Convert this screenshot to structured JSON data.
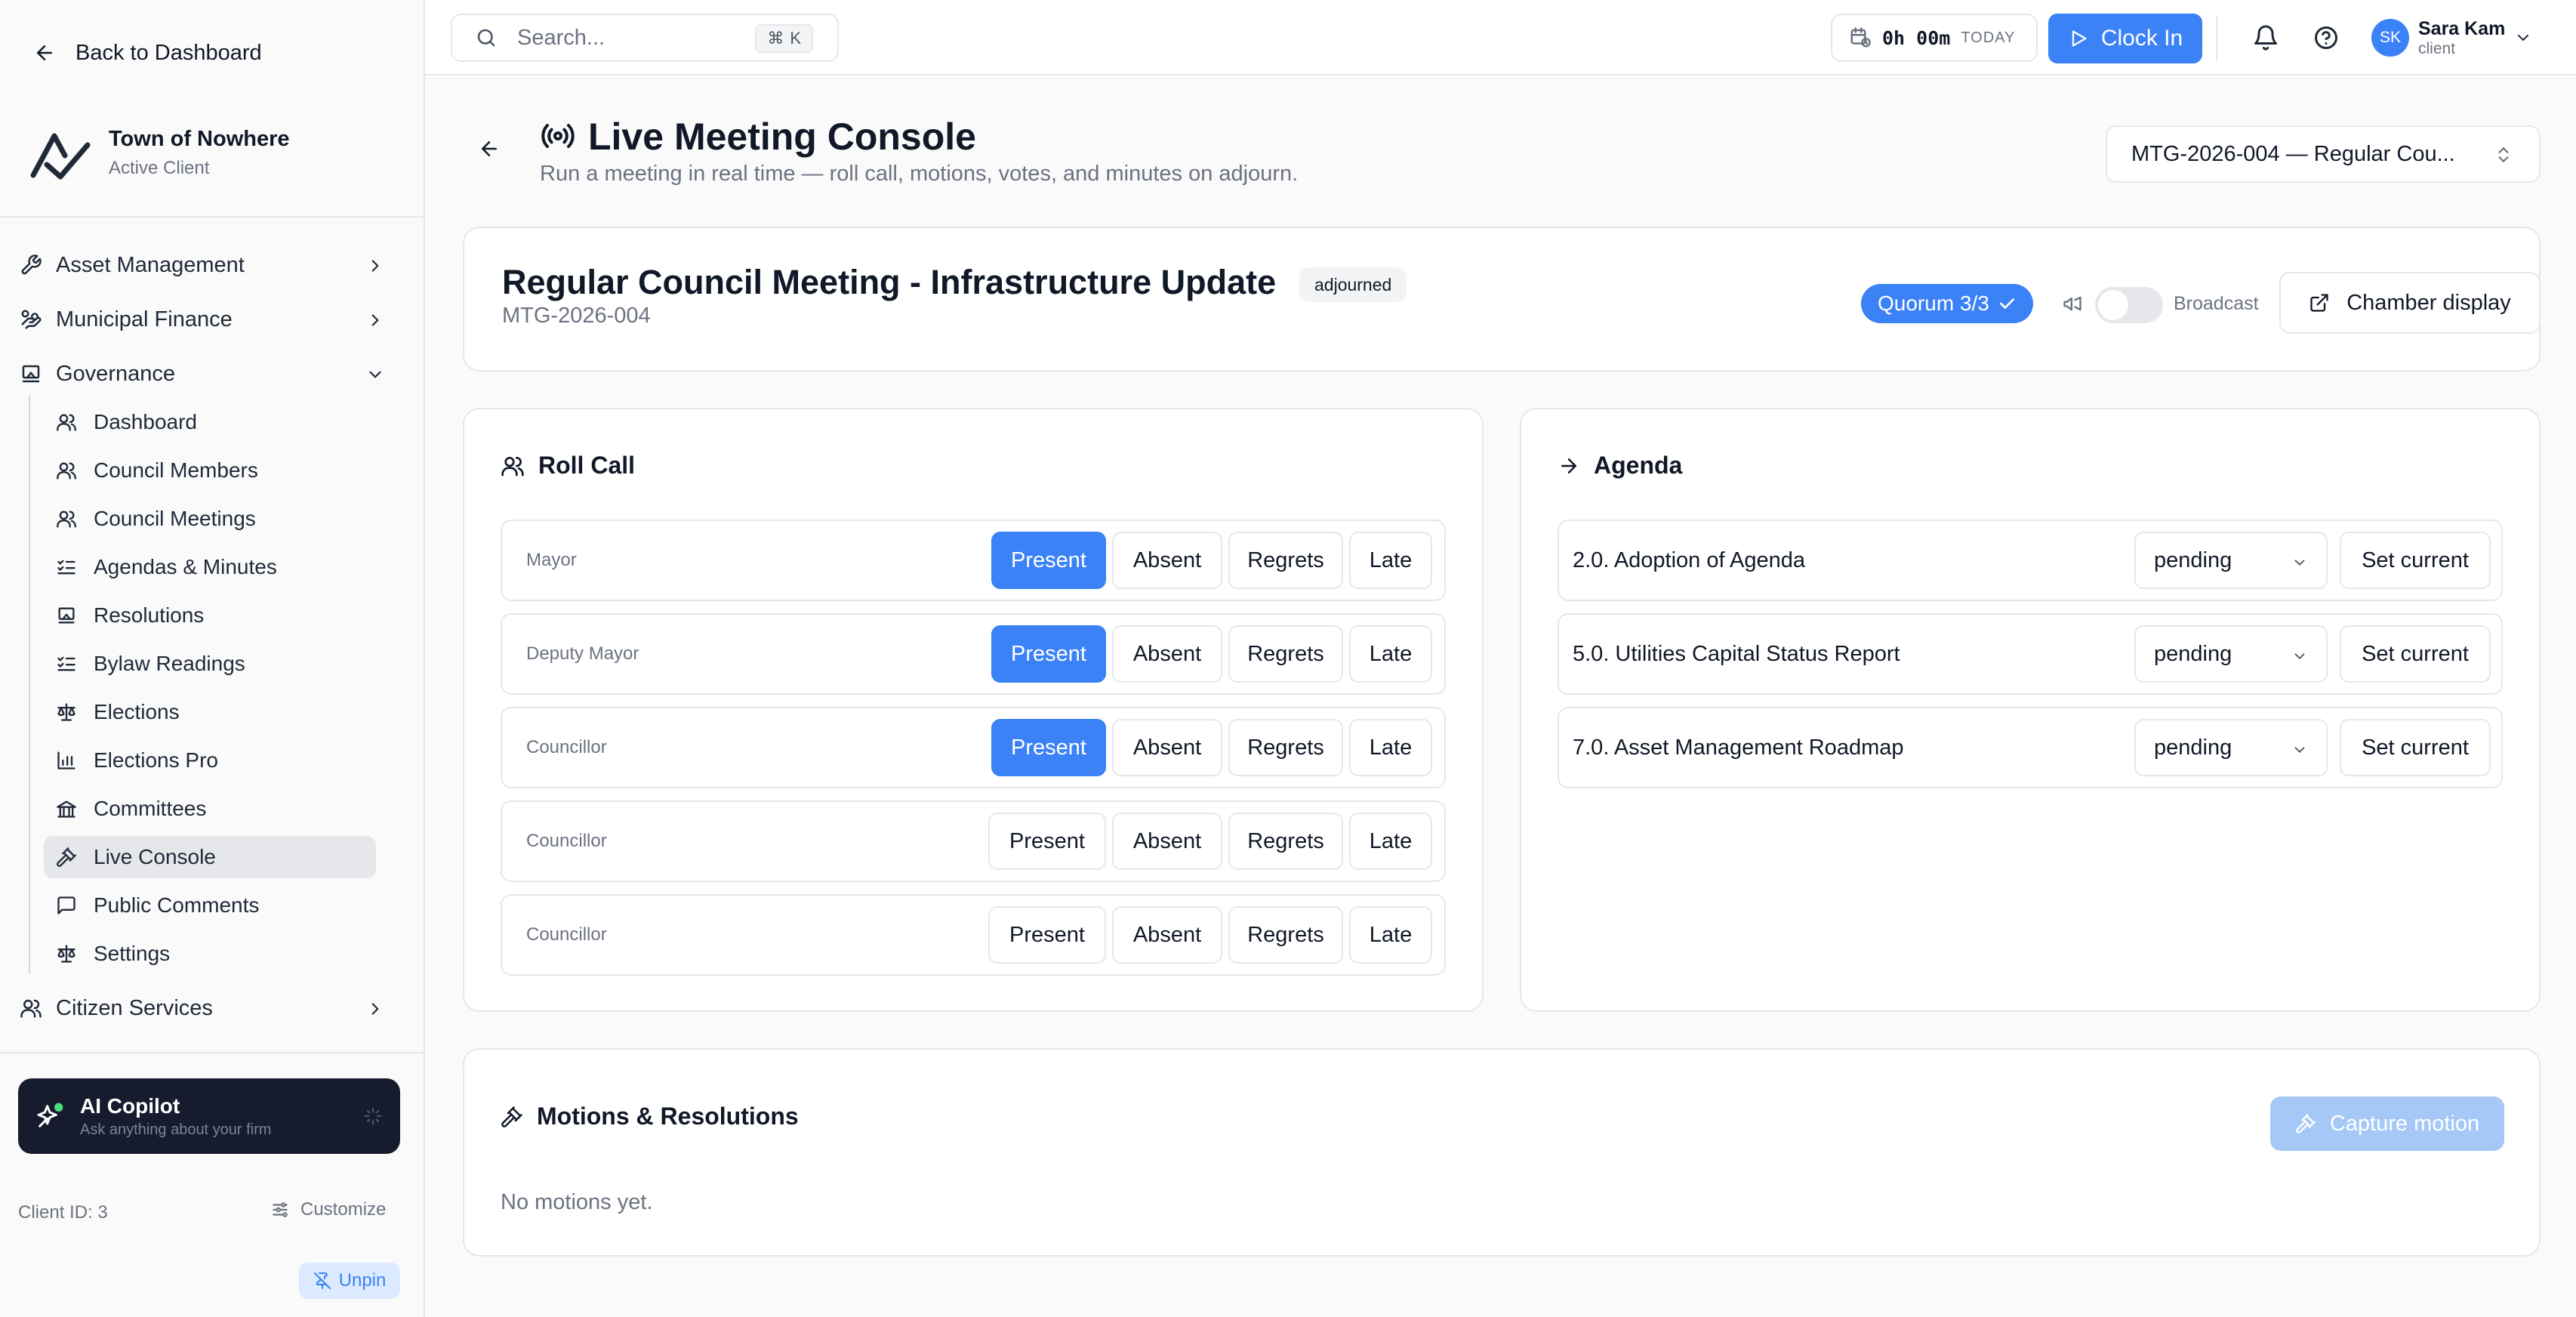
{
  "sidebar": {
    "back_label": "Back to Dashboard",
    "client_name": "Town of Nowhere",
    "client_status": "Active Client",
    "groups": [
      {
        "label": "Asset Management",
        "icon": "wrench-icon"
      },
      {
        "label": "Municipal Finance",
        "icon": "hand-coins-icon"
      },
      {
        "label": "Governance",
        "icon": "landmark-icon"
      },
      {
        "label": "Citizen Services",
        "icon": "users-icon"
      }
    ],
    "items": [
      {
        "label": "Dashboard",
        "icon": "users-icon"
      },
      {
        "label": "Council Members",
        "icon": "users-icon"
      },
      {
        "label": "Council Meetings",
        "icon": "users-icon"
      },
      {
        "label": "Agendas & Minutes",
        "icon": "list-checks-icon"
      },
      {
        "label": "Resolutions",
        "icon": "landmark-icon"
      },
      {
        "label": "Bylaw Readings",
        "icon": "list-checks-icon"
      },
      {
        "label": "Elections",
        "icon": "scale-icon"
      },
      {
        "label": "Elections Pro",
        "icon": "bar-chart-icon"
      },
      {
        "label": "Committees",
        "icon": "building-icon"
      },
      {
        "label": "Live Console",
        "icon": "gavel-icon"
      },
      {
        "label": "Public Comments",
        "icon": "message-square-icon"
      },
      {
        "label": "Settings",
        "icon": "scale-icon"
      }
    ],
    "active_item": "Live Console",
    "copilot_title": "AI Copilot",
    "copilot_sub": "Ask anything about your firm",
    "client_id": "Client ID: 3",
    "customize_label": "Customize",
    "unpin_label": "Unpin"
  },
  "topbar": {
    "search_placeholder": "Search...",
    "shortcut_symbol": "⌘",
    "shortcut_key": "K",
    "timer_value": "0h 00m",
    "timer_period": "TODAY",
    "clock_in_label": "Clock In",
    "user_initials": "SK",
    "user_name": "Sara Kam",
    "user_role": "client"
  },
  "page": {
    "title": "Live Meeting Console",
    "subtitle": "Run a meeting in real time — roll call, motions, votes, and minutes on adjourn.",
    "meeting_selector": "MTG-2026-004 — Regular Cou..."
  },
  "meeting": {
    "title": "Regular Council Meeting - Infrastructure Update",
    "status": "adjourned",
    "id": "MTG-2026-004",
    "quorum": "Quorum 3/3",
    "broadcast_label": "Broadcast",
    "broadcast_on": false,
    "chamber_label": "Chamber display"
  },
  "roll_call": {
    "title": "Roll Call",
    "options": [
      "Present",
      "Absent",
      "Regrets",
      "Late"
    ],
    "members": [
      {
        "role": "Mayor",
        "status": "Present"
      },
      {
        "role": "Deputy Mayor",
        "status": "Present"
      },
      {
        "role": "Councillor",
        "status": "Present"
      },
      {
        "role": "Councillor",
        "status": ""
      },
      {
        "role": "Councillor",
        "status": ""
      }
    ]
  },
  "agenda": {
    "title": "Agenda",
    "set_current_label": "Set current",
    "items": [
      {
        "label": "2.0. Adoption of Agenda",
        "status": "pending"
      },
      {
        "label": "5.0. Utilities Capital Status Report",
        "status": "pending"
      },
      {
        "label": "7.0. Asset Management Roadmap",
        "status": "pending"
      }
    ]
  },
  "motions": {
    "title": "Motions & Resolutions",
    "capture_label": "Capture motion",
    "empty_text": "No motions yet."
  },
  "colors": {
    "accent": "#3b82f6",
    "accent_disabled": "#a6c8f7",
    "copilot_bg": "#171b2e"
  }
}
